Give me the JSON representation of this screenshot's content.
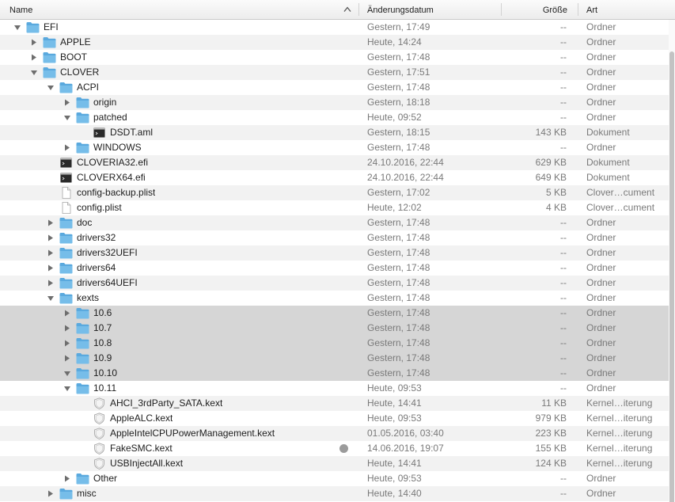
{
  "columns": {
    "name": "Name",
    "date": "Änderungsdatum",
    "size": "Größe",
    "kind": "Art"
  },
  "colors": {
    "folder": "#5aa9de",
    "folder_tab": "#76bde9",
    "selected": "#d6d6d6",
    "stripe": "#f2f2f2"
  },
  "rows": [
    {
      "name": "EFI",
      "date": "Gestern, 17:49",
      "size": "--",
      "kind": "Ordner",
      "level": 0,
      "icon": "folder-icon",
      "disclosure": "expanded",
      "selected": false
    },
    {
      "name": "APPLE",
      "date": "Heute, 14:24",
      "size": "--",
      "kind": "Ordner",
      "level": 1,
      "icon": "folder-icon",
      "disclosure": "collapsed",
      "selected": false
    },
    {
      "name": "BOOT",
      "date": "Gestern, 17:48",
      "size": "--",
      "kind": "Ordner",
      "level": 1,
      "icon": "folder-icon",
      "disclosure": "collapsed",
      "selected": false
    },
    {
      "name": "CLOVER",
      "date": "Gestern, 17:51",
      "size": "--",
      "kind": "Ordner",
      "level": 1,
      "icon": "folder-icon",
      "disclosure": "expanded",
      "selected": false
    },
    {
      "name": "ACPI",
      "date": "Gestern, 17:48",
      "size": "--",
      "kind": "Ordner",
      "level": 2,
      "icon": "folder-icon",
      "disclosure": "expanded",
      "selected": false
    },
    {
      "name": "origin",
      "date": "Gestern, 18:18",
      "size": "--",
      "kind": "Ordner",
      "level": 3,
      "icon": "folder-icon",
      "disclosure": "collapsed",
      "selected": false
    },
    {
      "name": "patched",
      "date": "Heute, 09:52",
      "size": "--",
      "kind": "Ordner",
      "level": 3,
      "icon": "folder-icon",
      "disclosure": "expanded",
      "selected": false
    },
    {
      "name": "DSDT.aml",
      "date": "Gestern, 18:15",
      "size": "143 KB",
      "kind": "Dokument",
      "level": 4,
      "icon": "terminal-document-icon",
      "disclosure": "none",
      "selected": false
    },
    {
      "name": "WINDOWS",
      "date": "Gestern, 17:48",
      "size": "--",
      "kind": "Ordner",
      "level": 3,
      "icon": "folder-icon",
      "disclosure": "collapsed",
      "selected": false
    },
    {
      "name": "CLOVERIA32.efi",
      "date": "24.10.2016, 22:44",
      "size": "629 KB",
      "kind": "Dokument",
      "level": 2,
      "icon": "terminal-document-icon",
      "disclosure": "none",
      "selected": false
    },
    {
      "name": "CLOVERX64.efi",
      "date": "24.10.2016, 22:44",
      "size": "649 KB",
      "kind": "Dokument",
      "level": 2,
      "icon": "terminal-document-icon",
      "disclosure": "none",
      "selected": false
    },
    {
      "name": "config-backup.plist",
      "date": "Gestern, 17:02",
      "size": "5 KB",
      "kind": "Clover…cument",
      "level": 2,
      "icon": "plain-document-icon",
      "disclosure": "none",
      "selected": false
    },
    {
      "name": "config.plist",
      "date": "Heute, 12:02",
      "size": "4 KB",
      "kind": "Clover…cument",
      "level": 2,
      "icon": "plain-document-icon",
      "disclosure": "none",
      "selected": false
    },
    {
      "name": "doc",
      "date": "Gestern, 17:48",
      "size": "--",
      "kind": "Ordner",
      "level": 2,
      "icon": "folder-icon",
      "disclosure": "collapsed",
      "selected": false
    },
    {
      "name": "drivers32",
      "date": "Gestern, 17:48",
      "size": "--",
      "kind": "Ordner",
      "level": 2,
      "icon": "folder-icon",
      "disclosure": "collapsed",
      "selected": false
    },
    {
      "name": "drivers32UEFI",
      "date": "Gestern, 17:48",
      "size": "--",
      "kind": "Ordner",
      "level": 2,
      "icon": "folder-icon",
      "disclosure": "collapsed",
      "selected": false
    },
    {
      "name": "drivers64",
      "date": "Gestern, 17:48",
      "size": "--",
      "kind": "Ordner",
      "level": 2,
      "icon": "folder-icon",
      "disclosure": "collapsed",
      "selected": false
    },
    {
      "name": "drivers64UEFI",
      "date": "Gestern, 17:48",
      "size": "--",
      "kind": "Ordner",
      "level": 2,
      "icon": "folder-icon",
      "disclosure": "collapsed",
      "selected": false
    },
    {
      "name": "kexts",
      "date": "Gestern, 17:48",
      "size": "--",
      "kind": "Ordner",
      "level": 2,
      "icon": "folder-icon",
      "disclosure": "expanded",
      "selected": false
    },
    {
      "name": "10.6",
      "date": "Gestern, 17:48",
      "size": "--",
      "kind": "Ordner",
      "level": 3,
      "icon": "folder-icon",
      "disclosure": "collapsed",
      "selected": true
    },
    {
      "name": "10.7",
      "date": "Gestern, 17:48",
      "size": "--",
      "kind": "Ordner",
      "level": 3,
      "icon": "folder-icon",
      "disclosure": "collapsed",
      "selected": true
    },
    {
      "name": "10.8",
      "date": "Gestern, 17:48",
      "size": "--",
      "kind": "Ordner",
      "level": 3,
      "icon": "folder-icon",
      "disclosure": "collapsed",
      "selected": true
    },
    {
      "name": "10.9",
      "date": "Gestern, 17:48",
      "size": "--",
      "kind": "Ordner",
      "level": 3,
      "icon": "folder-icon",
      "disclosure": "collapsed",
      "selected": true
    },
    {
      "name": "10.10",
      "date": "Gestern, 17:48",
      "size": "--",
      "kind": "Ordner",
      "level": 3,
      "icon": "folder-icon",
      "disclosure": "expanded",
      "selected": true
    },
    {
      "name": "10.11",
      "date": "Heute, 09:53",
      "size": "--",
      "kind": "Ordner",
      "level": 3,
      "icon": "folder-icon",
      "disclosure": "expanded",
      "selected": false
    },
    {
      "name": "AHCI_3rdParty_SATA.kext",
      "date": "Heute, 14:41",
      "size": "11 KB",
      "kind": "Kernel…iterung",
      "level": 4,
      "icon": "kext-shield-icon",
      "disclosure": "none",
      "selected": false
    },
    {
      "name": "AppleALC.kext",
      "date": "Heute, 09:53",
      "size": "979 KB",
      "kind": "Kernel…iterung",
      "level": 4,
      "icon": "kext-shield-icon",
      "disclosure": "none",
      "selected": false
    },
    {
      "name": "AppleIntelCPUPowerManagement.kext",
      "date": "01.05.2016, 03:40",
      "size": "223 KB",
      "kind": "Kernel…iterung",
      "level": 4,
      "icon": "kext-shield-icon",
      "disclosure": "none",
      "selected": false
    },
    {
      "name": "FakeSMC.kext",
      "date": "14.06.2016, 19:07",
      "size": "155 KB",
      "kind": "Kernel…iterung",
      "level": 4,
      "icon": "kext-shield-icon",
      "disclosure": "none",
      "selected": false,
      "tag": "gray"
    },
    {
      "name": "USBInjectAll.kext",
      "date": "Heute, 14:41",
      "size": "124 KB",
      "kind": "Kernel…iterung",
      "level": 4,
      "icon": "kext-shield-icon",
      "disclosure": "none",
      "selected": false
    },
    {
      "name": "Other",
      "date": "Heute, 09:53",
      "size": "--",
      "kind": "Ordner",
      "level": 3,
      "icon": "folder-icon",
      "disclosure": "collapsed",
      "selected": false
    },
    {
      "name": "misc",
      "date": "Heute, 14:40",
      "size": "--",
      "kind": "Ordner",
      "level": 2,
      "icon": "folder-icon",
      "disclosure": "collapsed",
      "selected": false
    }
  ]
}
